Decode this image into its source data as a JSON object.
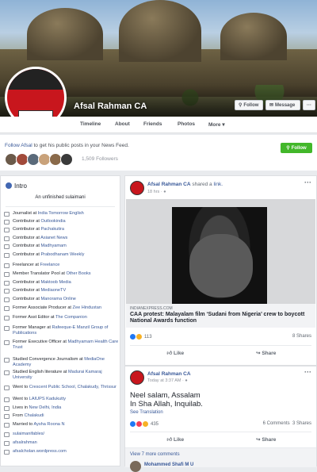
{
  "profile": {
    "name": "Afsal Rahman CA",
    "follow_label": "Follow",
    "message_label": "Message"
  },
  "nav": {
    "tabs": [
      "Timeline",
      "About",
      "Friends",
      "Photos",
      "More ▾"
    ]
  },
  "follow_bar": {
    "prefix": "Follow Afsal",
    "suffix": " to get his public posts in your News Feed.",
    "button": "Follow",
    "followers": "1,509 Followers"
  },
  "intro": {
    "heading": "Intro",
    "bio": "An unfinished sulaimani",
    "items": [
      {
        "text": "Journalist at ",
        "link": "India Tomorrow English"
      },
      {
        "text": "Contributor at ",
        "link": "Outlookindia"
      },
      {
        "text": "Contributor at ",
        "link": "Pachakutira"
      },
      {
        "text": "Contributor at ",
        "link": "Asianet News"
      },
      {
        "text": "Contributor at ",
        "link": "Madhyamam"
      },
      {
        "text": "Contributor at ",
        "link": "Prabodhanam Weekly"
      },
      {
        "text": "Freelancer at ",
        "link": "Freelance"
      },
      {
        "text": "Member Translator Pool at ",
        "link": "Other Books"
      },
      {
        "text": "Contributor at ",
        "link": "Maktoob Media"
      },
      {
        "text": "Contributor at ",
        "link": "MediaoneTV"
      },
      {
        "text": "Contributor at ",
        "link": "Manorama Online"
      },
      {
        "text": "Former Associate Producer at ",
        "link": "Zee Hindustan"
      },
      {
        "text": "Former Asst Editor at ",
        "link": "The Companion"
      },
      {
        "text": "Former Manager at ",
        "link": "Rafeeque-E Manzil Group of Publications"
      },
      {
        "text": "Former Executive Officer at ",
        "link": "Madhyamam Health Care Trust"
      },
      {
        "text": "Studied Convergence Journalism at ",
        "link": "MediaOne Academy"
      },
      {
        "text": "Studied English literature at ",
        "link": "Madurai Kamaraj University"
      },
      {
        "text": "Went to ",
        "link": "Crescent Public School, Chalakudy, Thrissur"
      },
      {
        "text": "Went to ",
        "link": "LAIUPS Kadukutty"
      },
      {
        "text": "Lives in ",
        "link": "New Delhi, India"
      },
      {
        "text": "From ",
        "link": "Chalakudi"
      },
      {
        "text": "Married to ",
        "link": "Aysha Roona N"
      },
      {
        "text": "",
        "link": "sulaimanifables/"
      },
      {
        "text": "",
        "link": "afsalrahman"
      },
      {
        "text": "",
        "link": "afsalcholan.wordpress.com"
      }
    ]
  },
  "post1": {
    "author": "Afsal Rahman CA",
    "action": " shared a ",
    "action_link": "link.",
    "time": "18 hrs · ",
    "domain": "INDIANEXPRESS.COM",
    "headline": "CAA protest: Malayalam film ‘Sudani from Nigeria’ crew to boycott National Awards function",
    "reactions": "113",
    "shares": "8 Shares",
    "like": "Like",
    "share": "Share",
    "info": "i"
  },
  "post2": {
    "author": "Afsal Rahman CA",
    "time": "Today at 3:37 AM · ",
    "text_line1": "Neel salam, Assalam",
    "text_line2": "In Sha Allah, Inquilab.",
    "see_translation": "See Translation",
    "reactions": "435",
    "comments": "6 Comments",
    "shares": "3 Shares",
    "like": "Like",
    "share": "Share",
    "more_comments": "View 7 more comments",
    "commenter": "Mohammed Shafi M U"
  },
  "colors": {
    "fb_blue": "#385898",
    "green": "#42b72a",
    "bg": "#e9ebee"
  }
}
